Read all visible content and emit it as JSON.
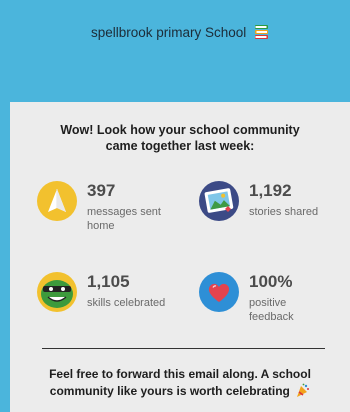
{
  "header": {
    "school_name": "spellbrook primary School",
    "icon": "book-stack-icon"
  },
  "headline": {
    "line1": "Wow! Look how your school community",
    "line2": "came together last week:"
  },
  "stats": [
    {
      "value": "397",
      "label_line1": "messages sent",
      "label_line2": "home",
      "icon": "paper-plane-icon",
      "color": "#f2c12e"
    },
    {
      "value": "1,192",
      "label_line1": "stories shared",
      "label_line2": "",
      "icon": "photo-frame-icon",
      "color": "#3c4a86"
    },
    {
      "value": "1,105",
      "label_line1": "skills celebrated",
      "label_line2": "",
      "icon": "monster-icon",
      "color": "#3d9a3c"
    },
    {
      "value": "100%",
      "label_line1": "positive",
      "label_line2": "feedback",
      "icon": "heart-icon",
      "color": "#2e8fd6"
    }
  ],
  "footer": {
    "line1": "Feel free to forward this email along. A school",
    "line2": "community like yours is worth celebrating",
    "icon": "party-popper-icon"
  },
  "colors": {
    "header_bg": "#4bb5dc",
    "panel_bg": "#ececec",
    "accent_yellow": "#f2c12e",
    "accent_blue": "#2e8fd6",
    "accent_red": "#e3434e"
  }
}
